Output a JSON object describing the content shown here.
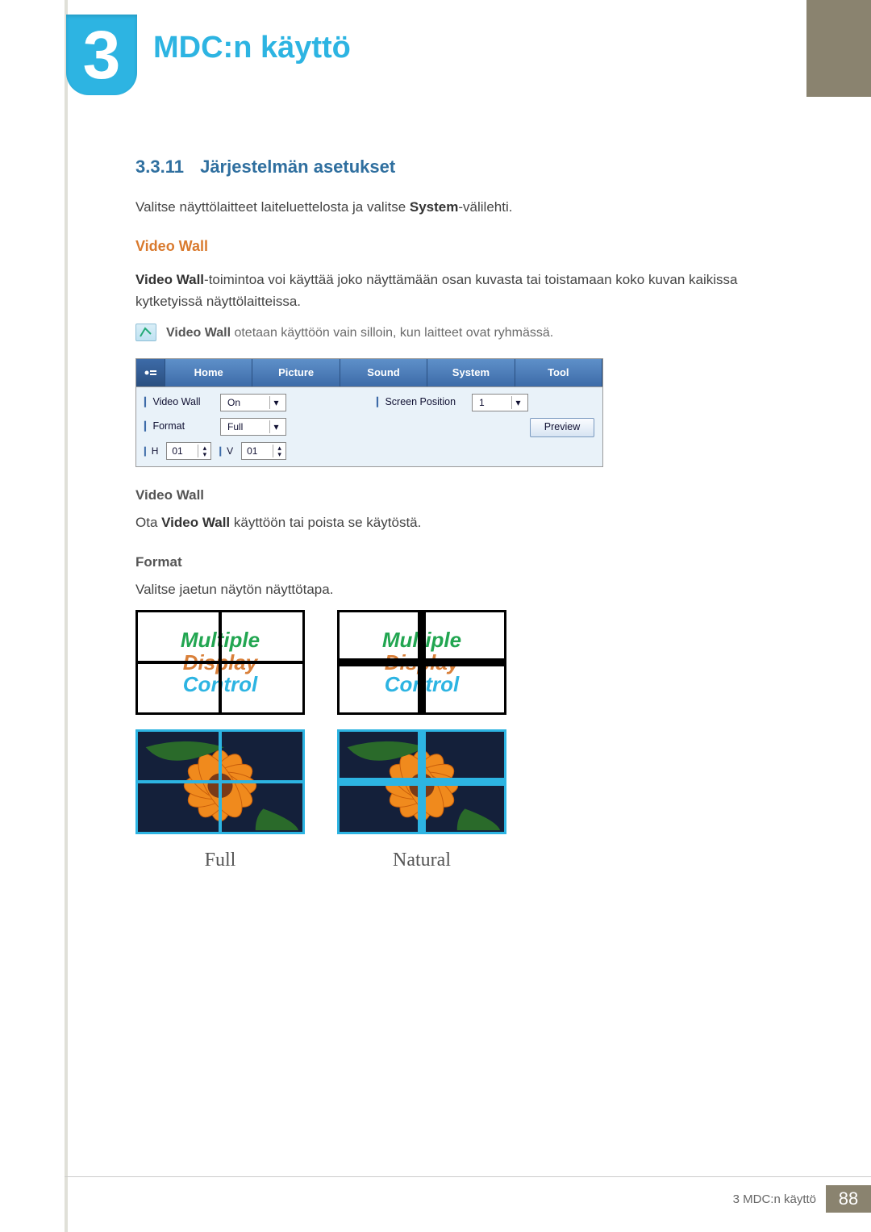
{
  "chapter": {
    "number": "3",
    "title": "MDC:n käyttö"
  },
  "section": {
    "number": "3.3.11",
    "title": "Järjestelmän asetukset",
    "intro_prefix": "Valitse näyttölaitteet laiteluettelosta ja valitse ",
    "intro_bold": "System",
    "intro_suffix": "-välilehti."
  },
  "video_wall": {
    "heading": "Video Wall",
    "p1_bold": "Video Wall",
    "p1_rest": "-toimintoa voi käyttää joko näyttämään osan kuvasta tai toistamaan koko kuvan kaikissa kytketyissä näyttölaitteissa.",
    "note_bold": "Video Wall",
    "note_rest": " otetaan käyttöön vain silloin, kun laitteet ovat ryhmässä.",
    "sub1": "Video Wall",
    "sub1_body_prefix": "Ota ",
    "sub1_body_bold": "Video Wall",
    "sub1_body_suffix": " käyttöön tai poista se käytöstä.",
    "sub2": "Format",
    "sub2_body": "Valitse jaetun näytön näyttötapa."
  },
  "mdc_panel": {
    "tabs": [
      "Home",
      "Picture",
      "Sound",
      "System",
      "Tool"
    ],
    "left": {
      "video_wall_label": "Video Wall",
      "video_wall_value": "On",
      "format_label": "Format",
      "format_value": "Full",
      "h_label": "H",
      "h_value": "01",
      "v_label": "V",
      "v_value": "01"
    },
    "right": {
      "screen_position_label": "Screen Position",
      "screen_position_value": "1",
      "preview_label": "Preview"
    }
  },
  "format_examples": {
    "text_lines": [
      "Multiple",
      "Display",
      "Control"
    ],
    "left_caption": "Full",
    "right_caption": "Natural"
  },
  "footer": {
    "text": "3 MDC:n käyttö",
    "page": "88"
  }
}
